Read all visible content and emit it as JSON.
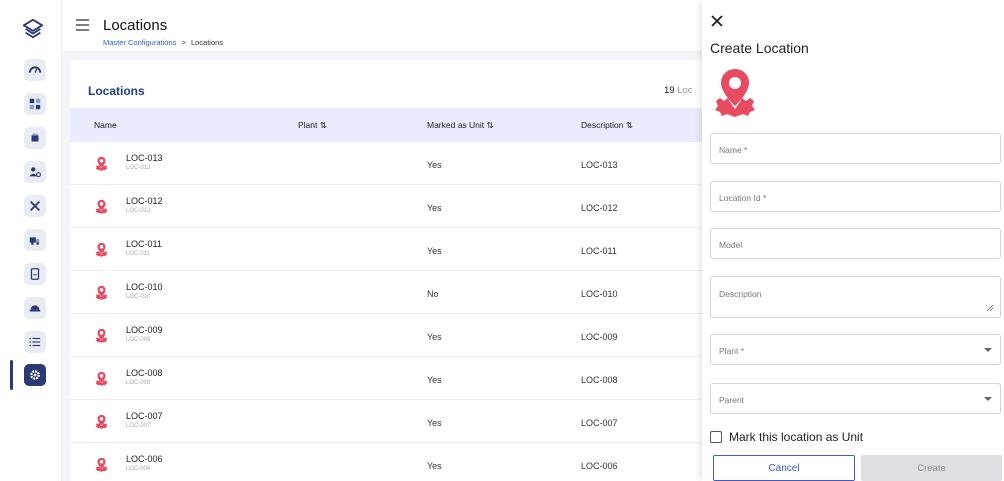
{
  "colors": {
    "accent": "#2b3a75",
    "link": "#2b5fd0",
    "location_icon": "#e84a5f",
    "button_primary": "#3d5bd1",
    "table_header_bg": "#e8ecfc"
  },
  "sidebar": {
    "logo_icon": "stacked-layers-logo",
    "items": [
      {
        "icon": "gauge-icon"
      },
      {
        "icon": "dashboard-grid-icon"
      },
      {
        "icon": "box-icon"
      },
      {
        "icon": "user-settings-icon"
      },
      {
        "icon": "tools-icon"
      },
      {
        "icon": "truck-icon"
      },
      {
        "icon": "document-icon"
      },
      {
        "icon": "helmet-icon"
      },
      {
        "icon": "list-icon"
      },
      {
        "icon": "gear-icon",
        "active": true
      }
    ]
  },
  "header": {
    "title": "Locations",
    "breadcrumb": {
      "link": "Master Configurations",
      "separator": ">",
      "current": "Locations"
    }
  },
  "card": {
    "title": "Locations",
    "count_number": "19",
    "count_label": "Loc"
  },
  "table": {
    "columns": {
      "name": "Name",
      "plant": "Plant ⇅",
      "marked": "Marked as Unit ⇅",
      "description": "Description ⇅"
    },
    "rows": [
      {
        "name": "LOC-013",
        "code": "LOC-013",
        "marked": "Yes",
        "description": "LOC-013"
      },
      {
        "name": "LOC-012",
        "code": "LOC-012",
        "marked": "Yes",
        "description": "LOC-012"
      },
      {
        "name": "LOC-011",
        "code": "LOC-011",
        "marked": "Yes",
        "description": "LOC-011"
      },
      {
        "name": "LOC-010",
        "code": "LOC-010",
        "marked": "No",
        "description": "LOC-010"
      },
      {
        "name": "LOC-009",
        "code": "LOC-009",
        "marked": "Yes",
        "description": "LOC-009"
      },
      {
        "name": "LOC-008",
        "code": "LOC-008",
        "marked": "Yes",
        "description": "LOC-008"
      },
      {
        "name": "LOC-007",
        "code": "LOC-007",
        "marked": "Yes",
        "description": "LOC-007"
      },
      {
        "name": "LOC-006",
        "code": "LOC-006",
        "marked": "Yes",
        "description": "LOC-006"
      }
    ]
  },
  "drawer": {
    "title": "Create Location",
    "icon": "location-gear-icon",
    "fields": {
      "name": "Name *",
      "location_id": "Location Id *",
      "model": "Model",
      "description": "Description",
      "plant": "Plant *",
      "parent": "Parent"
    },
    "checkbox_label": "Mark this location as Unit",
    "cancel_label": "Cancel",
    "create_label": "Create"
  }
}
